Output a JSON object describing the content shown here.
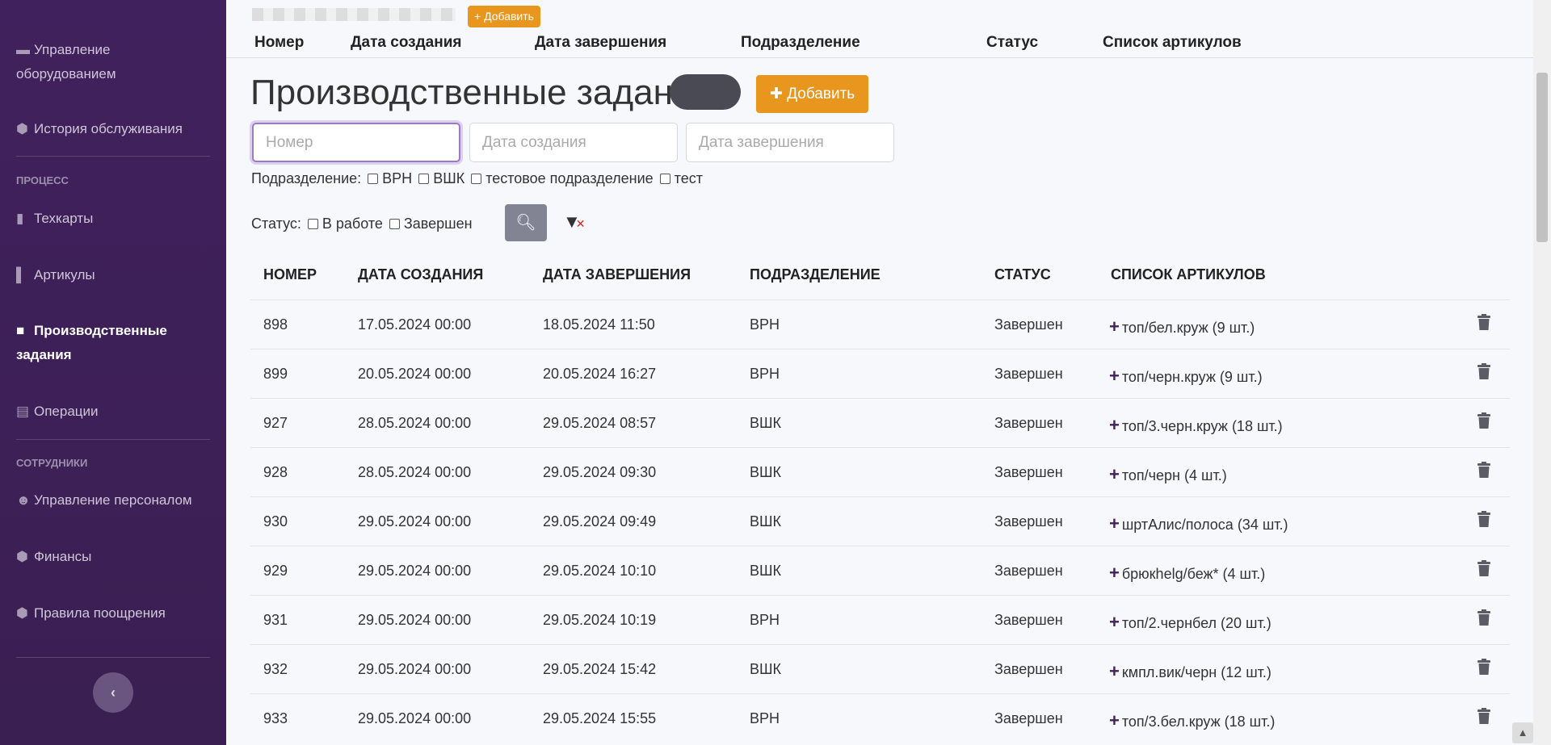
{
  "sidebar": {
    "items": [
      {
        "label": "Управление оборудованием",
        "icon": "equipment-icon"
      },
      {
        "label": "История обслуживания",
        "icon": "cube-icon"
      },
      {
        "label": "Техкарты",
        "icon": "book-icon"
      },
      {
        "label": "Артикулы",
        "icon": "ruler-icon"
      },
      {
        "label": "Производственные задания",
        "icon": "briefcase-icon"
      },
      {
        "label": "Операции",
        "icon": "clipboard-icon"
      },
      {
        "label": "Управление персоналом",
        "icon": "users-icon"
      },
      {
        "label": "Финансы",
        "icon": "cube-icon"
      },
      {
        "label": "Правила поощрения",
        "icon": "cube-icon"
      }
    ],
    "sections": {
      "process": "ПРОЦЕСС",
      "employees": "СОТРУДНИКИ"
    },
    "collapse": "‹"
  },
  "sticky": {
    "add": "Добавить",
    "columns": [
      "Номер",
      "Дата создания",
      "Дата завершения",
      "Подразделение",
      "Статус",
      "Список артикулов"
    ]
  },
  "page": {
    "title": "Производственные задания",
    "add": "Добавить"
  },
  "filters": {
    "number_placeholder": "Номер",
    "created_placeholder": "Дата создания",
    "finished_placeholder": "Дата завершения",
    "division_label": "Подразделение:",
    "divisions": [
      "ВРН",
      "ВШК",
      "тестовое подразделение",
      "тест"
    ],
    "status_label": "Статус:",
    "statuses": [
      "В работе",
      "Завершен"
    ]
  },
  "table": {
    "columns": [
      "НОМЕР",
      "ДАТА СОЗДАНИЯ",
      "ДАТА ЗАВЕРШЕНИЯ",
      "ПОДРАЗДЕЛЕНИЕ",
      "СТАТУС",
      "СПИСОК АРТИКУЛОВ"
    ],
    "rows": [
      [
        "898",
        "17.05.2024 00:00",
        "18.05.2024 11:50",
        "ВРН",
        "Завершен",
        "топ/бел.круж (9 шт.)"
      ],
      [
        "899",
        "20.05.2024 00:00",
        "20.05.2024 16:27",
        "ВРН",
        "Завершен",
        "топ/черн.круж (9 шт.)"
      ],
      [
        "927",
        "28.05.2024 00:00",
        "29.05.2024 08:57",
        "ВШК",
        "Завершен",
        "топ/3.черн.круж (18 шт.)"
      ],
      [
        "928",
        "28.05.2024 00:00",
        "29.05.2024 09:30",
        "ВШК",
        "Завершен",
        "топ/черн (4 шт.)"
      ],
      [
        "930",
        "29.05.2024 00:00",
        "29.05.2024 09:49",
        "ВШК",
        "Завершен",
        "шртАлис/полоса (34 шт.)"
      ],
      [
        "929",
        "29.05.2024 00:00",
        "29.05.2024 10:10",
        "ВШК",
        "Завершен",
        "брюкhelg/беж* (4 шт.)"
      ],
      [
        "931",
        "29.05.2024 00:00",
        "29.05.2024 10:19",
        "ВРН",
        "Завершен",
        "топ/2.чернбел (20 шт.)"
      ],
      [
        "932",
        "29.05.2024 00:00",
        "29.05.2024 15:42",
        "ВШК",
        "Завершен",
        "кмпл.вик/черн (12 шт.)"
      ],
      [
        "933",
        "29.05.2024 00:00",
        "29.05.2024 15:55",
        "ВРН",
        "Завершен",
        "топ/3.бел.круж (18 шт.)"
      ]
    ]
  },
  "colors": {
    "sidebar": "#41215d",
    "accent": "#e8961d"
  }
}
